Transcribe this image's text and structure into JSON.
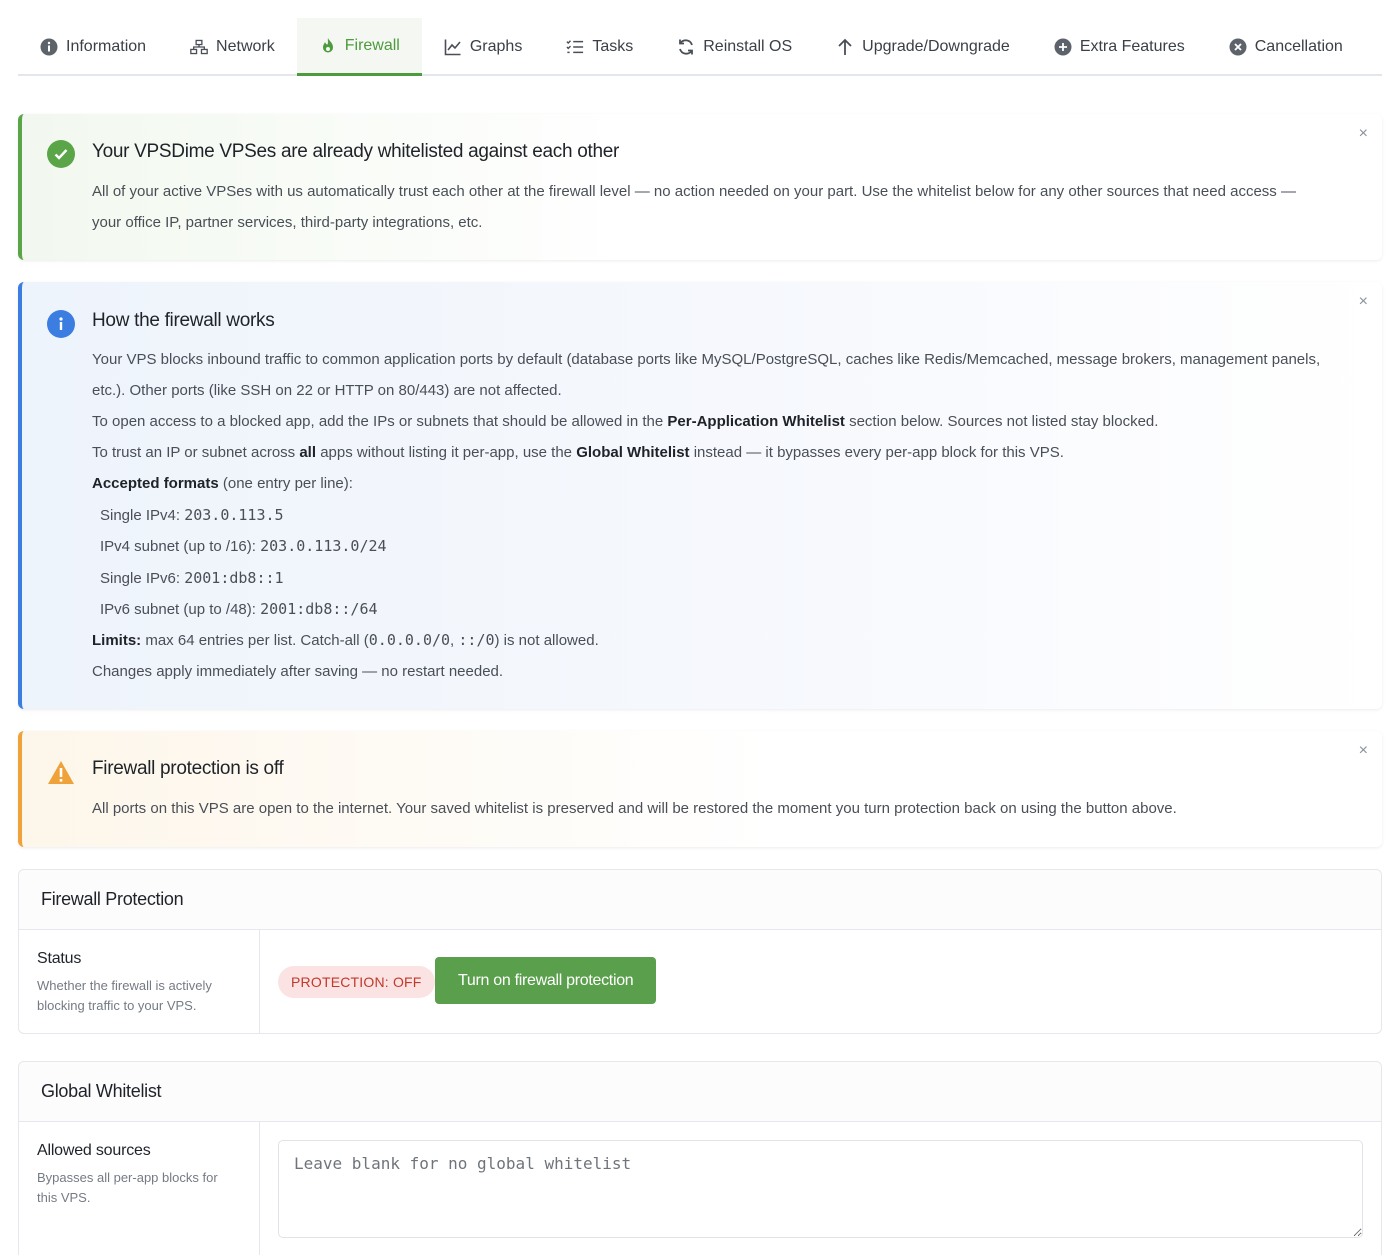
{
  "tabs": [
    {
      "label": "Information",
      "icon": "info-circle-icon"
    },
    {
      "label": "Network",
      "icon": "network-icon"
    },
    {
      "label": "Firewall",
      "icon": "fire-icon",
      "active": true
    },
    {
      "label": "Graphs",
      "icon": "line-chart-icon"
    },
    {
      "label": "Tasks",
      "icon": "task-list-icon"
    },
    {
      "label": "Reinstall OS",
      "icon": "refresh-icon"
    },
    {
      "label": "Upgrade/Downgrade",
      "icon": "arrow-up-icon"
    },
    {
      "label": "Extra Features",
      "icon": "plus-circle-icon"
    },
    {
      "label": "Cancellation",
      "icon": "x-circle-icon"
    }
  ],
  "alerts": {
    "close_glyph": "×",
    "whitelisted": {
      "title": "Your VPSDime VPSes are already whitelisted against each other",
      "line1": "All of your active VPSes with us automatically trust each other at the firewall level — no action needed on your part. Use the whitelist below for any other sources that need access —",
      "line2": "your office IP, partner services, third-party integrations, etc."
    },
    "how": {
      "title": "How the firewall works",
      "p1_line1": "Your VPS blocks inbound traffic to common application ports by default (database ports like MySQL/PostgreSQL, caches like Redis/Memcached, message brokers, management panels,",
      "p1_line2": "etc.). Other ports (like SSH on 22 or HTTP on 80/443) are not affected.",
      "p2_pre": "To open access to a blocked app, add the IPs or subnets that should be allowed in the",
      "p2_bold": "Per-Application Whitelist",
      "p2_post": "section below. Sources not listed stay blocked.",
      "p3_pre": "To trust an IP or subnet across",
      "p3_bold1": "all",
      "p3_mid": "apps without listing it per-app, use the",
      "p3_bold2": "Global Whitelist",
      "p3_post": "instead — it bypasses every per-app block for this VPS.",
      "formats_bold": "Accepted formats",
      "formats_note": "(one entry per line):",
      "formats": [
        {
          "label": "Single IPv4:",
          "value": "203.0.113.5"
        },
        {
          "label": "IPv4 subnet (up to /16):",
          "value": "203.0.113.0/24"
        },
        {
          "label": "Single IPv6:",
          "value": "2001:db8::1"
        },
        {
          "label": "IPv6 subnet (up to /48):",
          "value": "2001:db8::/64"
        }
      ],
      "limits_bold": "Limits:",
      "limits_pre": "max 64 entries per list. Catch-all (",
      "limits_code1": "0.0.0.0/0",
      "limits_sep": ",",
      "limits_code2": "::/0",
      "limits_post": ") is not allowed.",
      "changes": "Changes apply immediately after saving — no restart needed."
    },
    "off": {
      "title": "Firewall protection is off",
      "body": "All ports on this VPS are open to the internet. Your saved whitelist is preserved and will be restored the moment you turn protection back on using the button above."
    }
  },
  "protection_card": {
    "title": "Firewall Protection",
    "status_label": "Status",
    "status_desc": "Whether the firewall is actively blocking traffic to your VPS.",
    "badge": "PROTECTION: OFF",
    "button": "Turn on firewall protection"
  },
  "global_card": {
    "title": "Global Whitelist",
    "label": "Allowed sources",
    "desc": "Bypasses all per-app blocks for this VPS.",
    "placeholder": "Leave blank for no global whitelist",
    "value": ""
  },
  "colors": {
    "accent_green": "#5a9f4c",
    "info_blue": "#3b7de0",
    "warning_orange": "#efa13a",
    "badge_red": "#c0392b"
  }
}
